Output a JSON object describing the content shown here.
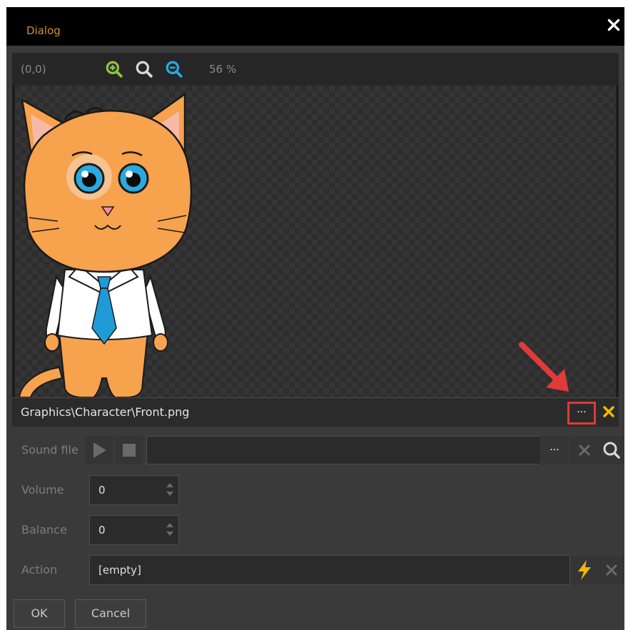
{
  "window": {
    "title": "Dialog"
  },
  "viewer": {
    "coords": "(0,0)",
    "zoom": "56 %"
  },
  "image_path": "Graphics\\Character\\Front.png",
  "browse_label": "···",
  "sound": {
    "label": "Sound file",
    "browse_label": "···"
  },
  "volume": {
    "label": "Volume",
    "value": "0"
  },
  "balance": {
    "label": "Balance",
    "value": "0"
  },
  "action": {
    "label": "Action",
    "value": "[empty]"
  },
  "buttons": {
    "ok": "OK",
    "cancel": "Cancel"
  },
  "colors": {
    "title": "#d58f2c",
    "zoom_in": "#8ec63f",
    "zoom_out": "#29a9e0",
    "clear": "#f2b705",
    "highlight": "#e03a3a"
  }
}
